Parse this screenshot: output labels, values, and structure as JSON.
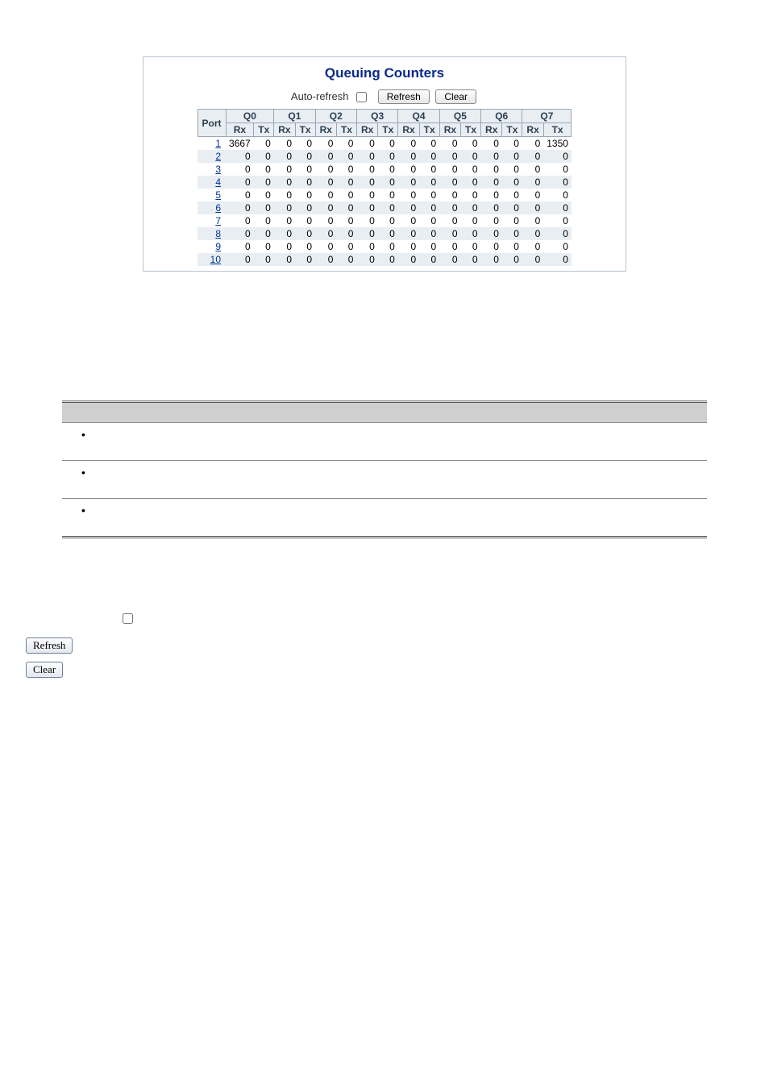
{
  "panel": {
    "title": "Queuing Counters",
    "auto_refresh_label": "Auto-refresh",
    "auto_refresh_checked": false,
    "refresh_label": "Refresh",
    "clear_label": "Clear"
  },
  "table": {
    "port_header": "Port",
    "queue_headers": [
      "Q0",
      "Q1",
      "Q2",
      "Q3",
      "Q4",
      "Q5",
      "Q6",
      "Q7"
    ],
    "sub_headers": [
      "Rx",
      "Tx"
    ],
    "rows": [
      {
        "port": "1",
        "cells": [
          "3667",
          "0",
          "0",
          "0",
          "0",
          "0",
          "0",
          "0",
          "0",
          "0",
          "0",
          "0",
          "0",
          "0",
          "0",
          "1350"
        ]
      },
      {
        "port": "2",
        "cells": [
          "0",
          "0",
          "0",
          "0",
          "0",
          "0",
          "0",
          "0",
          "0",
          "0",
          "0",
          "0",
          "0",
          "0",
          "0",
          "0"
        ]
      },
      {
        "port": "3",
        "cells": [
          "0",
          "0",
          "0",
          "0",
          "0",
          "0",
          "0",
          "0",
          "0",
          "0",
          "0",
          "0",
          "0",
          "0",
          "0",
          "0"
        ]
      },
      {
        "port": "4",
        "cells": [
          "0",
          "0",
          "0",
          "0",
          "0",
          "0",
          "0",
          "0",
          "0",
          "0",
          "0",
          "0",
          "0",
          "0",
          "0",
          "0"
        ]
      },
      {
        "port": "5",
        "cells": [
          "0",
          "0",
          "0",
          "0",
          "0",
          "0",
          "0",
          "0",
          "0",
          "0",
          "0",
          "0",
          "0",
          "0",
          "0",
          "0"
        ]
      },
      {
        "port": "6",
        "cells": [
          "0",
          "0",
          "0",
          "0",
          "0",
          "0",
          "0",
          "0",
          "0",
          "0",
          "0",
          "0",
          "0",
          "0",
          "0",
          "0"
        ]
      },
      {
        "port": "7",
        "cells": [
          "0",
          "0",
          "0",
          "0",
          "0",
          "0",
          "0",
          "0",
          "0",
          "0",
          "0",
          "0",
          "0",
          "0",
          "0",
          "0"
        ]
      },
      {
        "port": "8",
        "cells": [
          "0",
          "0",
          "0",
          "0",
          "0",
          "0",
          "0",
          "0",
          "0",
          "0",
          "0",
          "0",
          "0",
          "0",
          "0",
          "0"
        ]
      },
      {
        "port": "9",
        "cells": [
          "0",
          "0",
          "0",
          "0",
          "0",
          "0",
          "0",
          "0",
          "0",
          "0",
          "0",
          "0",
          "0",
          "0",
          "0",
          "0"
        ]
      },
      {
        "port": "10",
        "cells": [
          "0",
          "0",
          "0",
          "0",
          "0",
          "0",
          "0",
          "0",
          "0",
          "0",
          "0",
          "0",
          "0",
          "0",
          "0",
          "0"
        ]
      }
    ]
  },
  "loose": {
    "refresh_label": "Refresh",
    "clear_label": "Clear"
  },
  "chart_data": {
    "type": "table",
    "title": "Queuing Counters",
    "columns": [
      "Port",
      "Q0 Rx",
      "Q0 Tx",
      "Q1 Rx",
      "Q1 Tx",
      "Q2 Rx",
      "Q2 Tx",
      "Q3 Rx",
      "Q3 Tx",
      "Q4 Rx",
      "Q4 Tx",
      "Q5 Rx",
      "Q5 Tx",
      "Q6 Rx",
      "Q6 Tx",
      "Q7 Rx",
      "Q7 Tx"
    ],
    "rows": [
      [
        1,
        3667,
        0,
        0,
        0,
        0,
        0,
        0,
        0,
        0,
        0,
        0,
        0,
        0,
        0,
        0,
        1350
      ],
      [
        2,
        0,
        0,
        0,
        0,
        0,
        0,
        0,
        0,
        0,
        0,
        0,
        0,
        0,
        0,
        0,
        0
      ],
      [
        3,
        0,
        0,
        0,
        0,
        0,
        0,
        0,
        0,
        0,
        0,
        0,
        0,
        0,
        0,
        0,
        0
      ],
      [
        4,
        0,
        0,
        0,
        0,
        0,
        0,
        0,
        0,
        0,
        0,
        0,
        0,
        0,
        0,
        0,
        0
      ],
      [
        5,
        0,
        0,
        0,
        0,
        0,
        0,
        0,
        0,
        0,
        0,
        0,
        0,
        0,
        0,
        0,
        0
      ],
      [
        6,
        0,
        0,
        0,
        0,
        0,
        0,
        0,
        0,
        0,
        0,
        0,
        0,
        0,
        0,
        0,
        0
      ],
      [
        7,
        0,
        0,
        0,
        0,
        0,
        0,
        0,
        0,
        0,
        0,
        0,
        0,
        0,
        0,
        0,
        0
      ],
      [
        8,
        0,
        0,
        0,
        0,
        0,
        0,
        0,
        0,
        0,
        0,
        0,
        0,
        0,
        0,
        0,
        0
      ],
      [
        9,
        0,
        0,
        0,
        0,
        0,
        0,
        0,
        0,
        0,
        0,
        0,
        0,
        0,
        0,
        0,
        0
      ],
      [
        10,
        0,
        0,
        0,
        0,
        0,
        0,
        0,
        0,
        0,
        0,
        0,
        0,
        0,
        0,
        0,
        0
      ]
    ]
  }
}
